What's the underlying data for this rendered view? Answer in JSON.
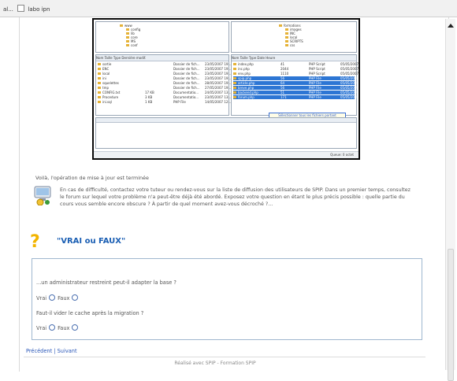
{
  "window": {
    "title": "al...",
    "tab_label": "labo ipn"
  },
  "screenshot": {
    "left_tree": [
      "www",
      "config",
      "lib",
      "core",
      "MS",
      "conf"
    ],
    "right_tree": [
      "formations",
      "images",
      "INC",
      "local",
      "SCRIPTS",
      "css"
    ],
    "left_headers": [
      "Nom",
      "Taille",
      "Type",
      "Dernière modif."
    ],
    "left_files": [
      [
        "sortie",
        "",
        "Dossier de fich...",
        "23/05/2007 19:..."
      ],
      [
        "ENC",
        "",
        "Dossier de fich...",
        "23/05/2007 19:..."
      ],
      [
        "local",
        "",
        "Dossier de fich...",
        "23/05/2007 19:..."
      ],
      [
        "ini",
        "",
        "Dossier de fich...",
        "23/05/2007 19:..."
      ],
      [
        "squelettes",
        "",
        "Dossier de fich...",
        "28/05/2007 19:..."
      ],
      [
        "tmp",
        "",
        "Dossier de fich...",
        "27/05/2007 19:..."
      ],
      [
        "CONFIG.txt",
        "17 KB",
        "Documentatio...",
        "24/05/2007 13:..."
      ],
      [
        "Procedure",
        "3 KB",
        "Documentatio...",
        "23/05/2007 13:..."
      ],
      [
        "ini.sql",
        "1 KB",
        "PHP File",
        "14/05/2007 12:..."
      ]
    ],
    "right_headers": [
      "Nom",
      "Taille",
      "Type",
      "Date",
      "Heure"
    ],
    "right_files": [
      [
        "index.php",
        "41",
        "PHP Script",
        "05/05/2007",
        "18:58"
      ],
      [
        "inc.php",
        "2044",
        "PHP Script",
        "05/05/2007",
        "18:58"
      ],
      [
        "env.php",
        "1110",
        "PHP Script",
        "05/05/2007",
        "18:58"
      ],
      [
        "spip.php",
        "56",
        "PHP File",
        "05/05/2007",
        "18:58"
      ],
      [
        "article.php",
        "64",
        "PHP File",
        "05/05/2007",
        "18:58"
      ],
      [
        "breve.php",
        "56",
        "PHP File",
        "05/05/2007",
        "18:58"
      ],
      [
        "backend.php",
        "51",
        "PHP File",
        "05/05/2007",
        "18:58"
      ],
      [
        "forum.php",
        "171",
        "PHP File",
        "05/05/2007",
        "18:58"
      ]
    ],
    "tip": "Sélectionner tous les fichiers portant l'extension .php3 et situés à la racine du site",
    "status": "Queue: 0 octet"
  },
  "content": {
    "done_text": "Voilà, l'opération de mise à jour est terminée",
    "help_text": "En cas de difficulté, contactez votre tuteur ou rendez-vous sur la liste de diffusion des utilisateurs de SPIP. Dans un premier temps, consultez le forum sur lequel votre problème n'a peut-être déjà été abordé. Exposez votre question en étant le plus précis possible : quelle partie du cours vous semble encore obscure ? À partir de quel moment avez-vous décroché ?..."
  },
  "quiz": {
    "title": "\"VRAI ou FAUX\"",
    "questions": [
      {
        "text": "...un administrateur restreint peut-il adapter la base ?",
        "opt1": "Vrai",
        "opt2": "Faux"
      },
      {
        "text": "Faut-il vider le cache après la migration ?",
        "opt1": "Vrai",
        "opt2": "Faux"
      }
    ]
  },
  "nav": {
    "previous": "Précédent",
    "separator": "|",
    "next": "Suivant"
  },
  "footer": "Réalisé avec SPIP - Formation SPIP"
}
